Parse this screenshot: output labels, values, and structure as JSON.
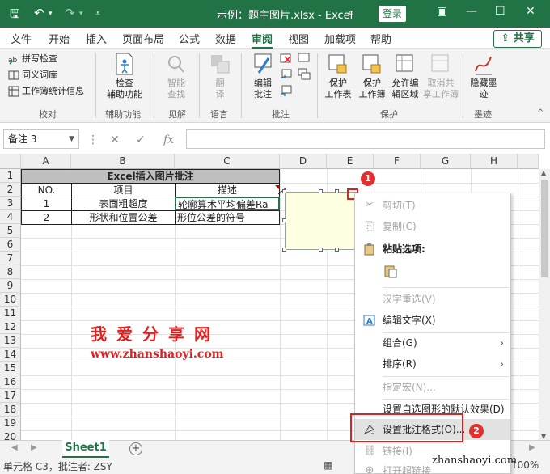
{
  "window": {
    "title": "示例：题主图片.xlsx  -  Excel",
    "login": "登录",
    "share": "共享"
  },
  "tabs": [
    "文件",
    "开始",
    "插入",
    "页面布局",
    "公式",
    "数据",
    "审阅",
    "视图",
    "加载项",
    "帮助"
  ],
  "active_tab": "审阅",
  "ribbon": {
    "proofing": {
      "items": [
        "拼写检查",
        "同义词库",
        "工作簿统计信息"
      ],
      "label": "校对"
    },
    "accessibility": {
      "button": "检查\n辅助功能",
      "label": "辅助功能"
    },
    "insights": {
      "button": "智能\n查找",
      "label": "见解"
    },
    "language": {
      "button": "翻\n译",
      "label": "语言"
    },
    "comments": {
      "button": "编辑\n批注",
      "label": "批注"
    },
    "protect": {
      "buttons": [
        "保护\n工作表",
        "保护\n工作簿",
        "允许编\n辑区域",
        "取消共\n享工作簿"
      ],
      "label": "保护"
    },
    "ink": {
      "button": "隐藏墨\n迹",
      "label": "墨迹"
    }
  },
  "formula_bar": {
    "name_box": "备注 3",
    "fx": "fx"
  },
  "columns": [
    "A",
    "B",
    "C",
    "D",
    "E",
    "F",
    "G",
    "H"
  ],
  "rows": [
    "1",
    "2",
    "3",
    "4",
    "5",
    "6",
    "7",
    "8",
    "9",
    "10",
    "11",
    "12",
    "13",
    "14",
    "15",
    "16",
    "17",
    "18",
    "19",
    "20"
  ],
  "table": {
    "title": "Excel插入图片批注",
    "headers": [
      "NO.",
      "项目",
      "描述"
    ],
    "rows": [
      [
        "1",
        "表面粗超度",
        "轮廓算术平均偏差Ra"
      ],
      [
        "2",
        "形状和位置公差",
        "形位公差的符号"
      ]
    ]
  },
  "badges": [
    "1",
    "2"
  ],
  "watermark": {
    "cn": "我爱分享网",
    "url": "www.zhanshaoyi.com"
  },
  "context_menu": {
    "cut": "剪切(T)",
    "copy": "复制(C)",
    "paste_header": "粘贴选项:",
    "reconvert": "汉字重选(V)",
    "edit_text": "编辑文字(X)",
    "group": "组合(G)",
    "order": "排序(R)",
    "assign_macro": "指定宏(N)...",
    "set_default": "设置自选图形的默认效果(D)",
    "format_comment": "设置批注格式(O)...",
    "link": "链接(I)",
    "open_link": "打开超链接"
  },
  "sheets": [
    "Sheet1"
  ],
  "status": {
    "text": "单元格 C3，批注者: ZSY",
    "zoom": "100%"
  },
  "site_url": "zhanshaoyi.com"
}
